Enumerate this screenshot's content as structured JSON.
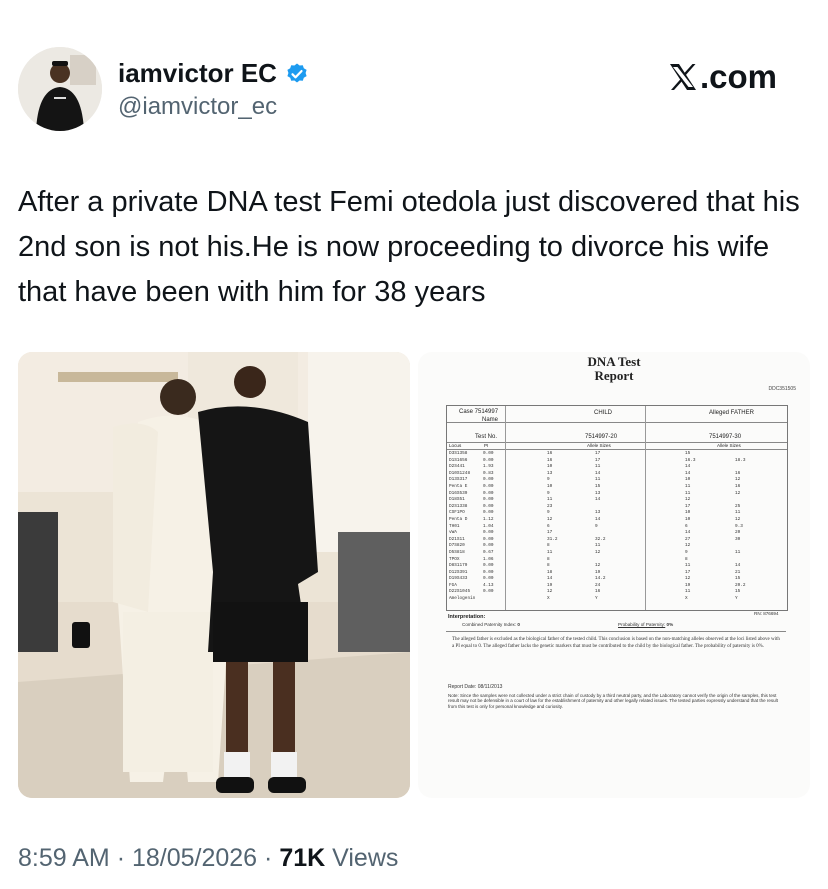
{
  "author": {
    "display_name": "iamvictor EC",
    "handle": "@iamvictor_ec",
    "verified": true,
    "verified_color": "#1d9bf0"
  },
  "brand": {
    "label": ".com",
    "logo_icon": "x-logo-icon"
  },
  "tweet": {
    "text": "After a private DNA test Femi otedola just discovered that his 2nd son is not his.He is now proceeding to divorce his wife that have been with him for 38 years"
  },
  "report": {
    "title_line1": "DNA Test",
    "title_line2": "Report",
    "doc_number": "DDC351505",
    "case_label": "Case 7514997",
    "name_label": "Name",
    "child_header": "CHILD",
    "father_header": "Alleged FATHER",
    "test_no_label": "Test No.",
    "child_test_no": "7514997-20",
    "father_test_no": "7514997-30",
    "locus_header": "Locus",
    "pi_header": "PI",
    "allele_header": "Allele Sizes",
    "loci": [
      "D3S1358",
      "D1S1656",
      "D2S441",
      "D10S1248",
      "D13S317",
      "Penta E",
      "D16S539",
      "D18S51",
      "D2S1338",
      "CSF1PO",
      "Penta D",
      "TH01",
      "vWA",
      "D21S11",
      "D7S820",
      "D5S818",
      "TPOX",
      "D8S1179",
      "D12S391",
      "D19S433",
      "FGA",
      "D22S1045",
      "Amelogenin"
    ],
    "pi_values": [
      "0.00",
      "0.00",
      "1.93",
      "0.83",
      "0.00",
      "0.00",
      "0.00",
      "0.00",
      "0.00",
      "0.00",
      "1.12",
      "1.04",
      "0.00",
      "0.00",
      "0.00",
      "0.67",
      "1.06",
      "0.00",
      "0.00",
      "0.00",
      "4.13",
      "0.00",
      ""
    ],
    "child_a1": [
      "16",
      "16",
      "10",
      "13",
      "9",
      "10",
      "9",
      "11",
      "23",
      "9",
      "12",
      "6",
      "17",
      "31.2",
      "8",
      "11",
      "8",
      "8",
      "18",
      "14",
      "19",
      "12",
      "X"
    ],
    "child_a2": [
      "17",
      "17",
      "11",
      "14",
      "11",
      "15",
      "13",
      "14",
      "",
      "13",
      "14",
      "9",
      "",
      "32.2",
      "11",
      "12",
      "",
      "12",
      "19",
      "14.2",
      "24",
      "16",
      "Y"
    ],
    "father_a1": [
      "15",
      "16.3",
      "14",
      "14",
      "10",
      "11",
      "11",
      "12",
      "17",
      "10",
      "10",
      "6",
      "14",
      "27",
      "12",
      "9",
      "8",
      "11",
      "17",
      "12",
      "19",
      "11",
      "X"
    ],
    "father_a2": [
      "",
      "18.3",
      "",
      "16",
      "12",
      "16",
      "12",
      "",
      "25",
      "11",
      "12",
      "9.3",
      "20",
      "30",
      "",
      "11",
      "",
      "14",
      "21",
      "15",
      "20.2",
      "15",
      "Y"
    ],
    "interpretation_label": "Interpretation:",
    "cpi_label": "Combined Paternity Index:",
    "cpi_value": "0",
    "probability_label": "Probability of Paternity:",
    "probability_value": "0%",
    "signature_code": "RN: 876694",
    "conclusion": "The alleged father is excluded as the biological father of the tested child. This conclusion is based on the non-matching alleles observed at the loci listed above with a PI equal to 0. The alleged father lacks the genetic markers that must be contributed to the child by the biological father. The probability of paternity is 0%.",
    "report_date": "Report Date: 08/11/2013",
    "note": "Note: Since the samples were not collected under a strict chain of custody by a third neutral party, and the Laboratory cannot verify the origin of the samples, this test result may not be defensible in a court of law for the establishment of paternity and other legally related issues. The tested parties expressly understand that the result from this test is only for personal knowledge and curiosity."
  },
  "meta": {
    "time": "8:59 AM",
    "separator": "·",
    "date": "18/05/2026",
    "views_count": "71K",
    "views_label": "Views"
  },
  "colors": {
    "text_primary": "#0f1419",
    "text_secondary": "#536471",
    "verified": "#1d9bf0"
  }
}
